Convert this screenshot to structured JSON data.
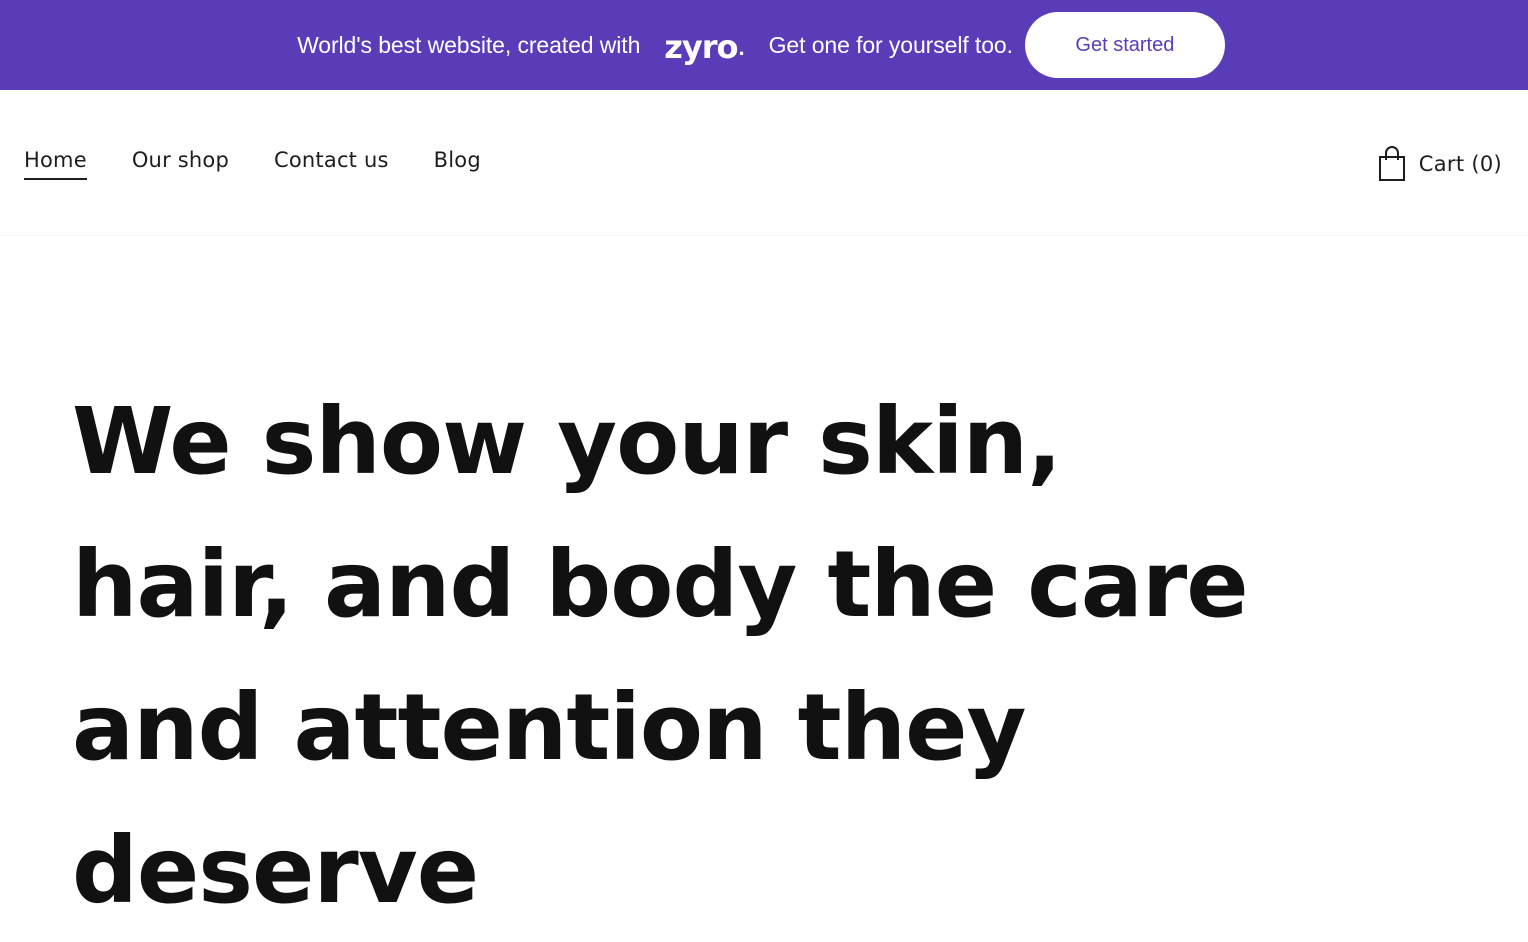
{
  "promo_banner": {
    "text_before_logo": "World's best website, created with",
    "logo_text": "zyro",
    "logo_dot": ".",
    "text_after_logo": "Get one for yourself too.",
    "cta_label": "Get started",
    "colors": {
      "background": "#5a3cb8",
      "cta_text": "#5a3cb8"
    }
  },
  "header": {
    "nav": [
      {
        "label": "Home",
        "active": true
      },
      {
        "label": "Our shop",
        "active": false
      },
      {
        "label": "Contact us",
        "active": false
      },
      {
        "label": "Blog",
        "active": false
      }
    ],
    "cart": {
      "icon": "shopping-bag-icon",
      "label": "Cart (0)"
    }
  },
  "hero": {
    "title": "We show your skin,\nhair, and body the care\nand attention they\ndeserve"
  }
}
